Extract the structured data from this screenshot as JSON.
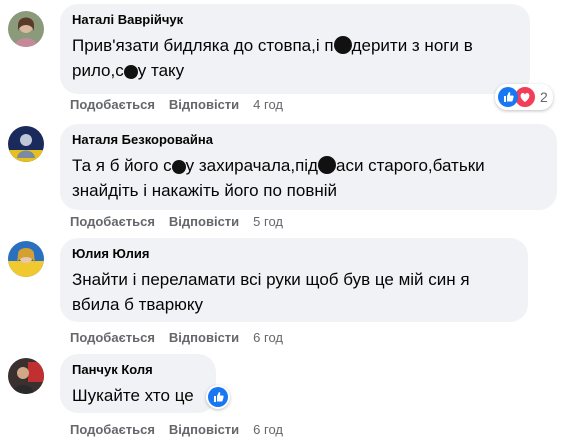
{
  "comments": [
    {
      "author": "Наталі Ваврійчук",
      "text_parts": [
        "Прив'язати бидляка до стовпа,і п",
        "дерити з ноги в рило,с",
        "у таку"
      ],
      "like_label": "Подобається",
      "reply_label": "Відповісти",
      "time": "4 год",
      "reaction_count": "2"
    },
    {
      "author": "Наталя Безкоровайна",
      "text_parts": [
        "Та я б його с",
        "у захирачала,під",
        "аси старого,батьки знайдіть і накажіть його по повній"
      ],
      "like_label": "Подобається",
      "reply_label": "Відповісти",
      "time": "5 год"
    },
    {
      "author": "Юлия Юлия",
      "text": "Знайти і переламати всі руки щоб був це мій син я вбила б тварюку",
      "like_label": "Подобається",
      "reply_label": "Відповісти",
      "time": "6 год"
    },
    {
      "author": "Панчук Коля",
      "text": "Шукайте хто це",
      "like_label": "Подобається",
      "reply_label": "Відповісти",
      "time": "6 год"
    }
  ],
  "colors": {
    "bubble": "#f0f2f5",
    "like_blue": "#1877f2",
    "love_red": "#f33e58",
    "meta_gray": "#65676b"
  },
  "icons": [
    "like-icon",
    "love-icon"
  ]
}
